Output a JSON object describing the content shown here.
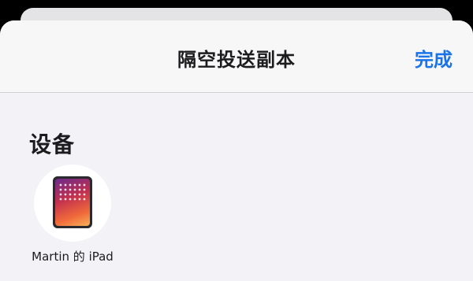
{
  "sheet": {
    "title": "隔空投送副本",
    "done_label": "完成"
  },
  "section": {
    "title": "设备"
  },
  "devices": [
    {
      "name": "Martin 的 iPad",
      "icon": "ipad-icon"
    }
  ],
  "colors": {
    "accent": "#1a73e8",
    "sheet_bg": "#f2f2f7",
    "nav_bg": "#f7f7f8"
  }
}
